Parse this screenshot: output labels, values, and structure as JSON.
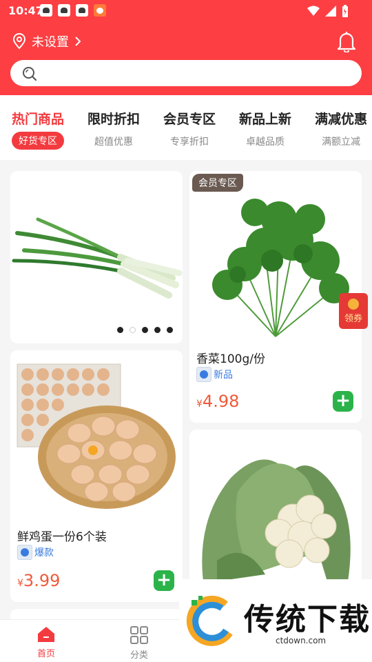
{
  "status_bar": {
    "time": "10:47"
  },
  "header": {
    "location_text": "未设置",
    "search": {
      "placeholder": ""
    }
  },
  "tabs": [
    {
      "title": "热门商品",
      "sub": "好货专区",
      "active": true
    },
    {
      "title": "限时折扣",
      "sub": "超值优惠"
    },
    {
      "title": "会员专区",
      "sub": "专享折扣"
    },
    {
      "title": "新品上新",
      "sub": "卓越品质"
    },
    {
      "title": "满减优惠",
      "sub": "满额立减"
    }
  ],
  "products": {
    "coriander": {
      "badge": "会员专区",
      "name": "香菜100g/份",
      "tag": "新品",
      "price_symbol": "¥",
      "price": "4.98"
    },
    "eggs": {
      "name": "鲜鸡蛋一份6个装",
      "tag": "爆款",
      "price_symbol": "¥",
      "price": "3.99"
    }
  },
  "banner": {
    "dots": 5,
    "active_dot": 1
  },
  "coupon": {
    "label": "领券"
  },
  "bottom_nav": [
    {
      "label": "首页",
      "active": true
    },
    {
      "label": "分类"
    }
  ],
  "watermark": {
    "text": "传统下载",
    "url": "ctdown.com"
  },
  "colors": {
    "brand": "#fd3e42",
    "price": "#f05a3a",
    "add": "#2bb34a",
    "tag": "#3a7be0"
  }
}
